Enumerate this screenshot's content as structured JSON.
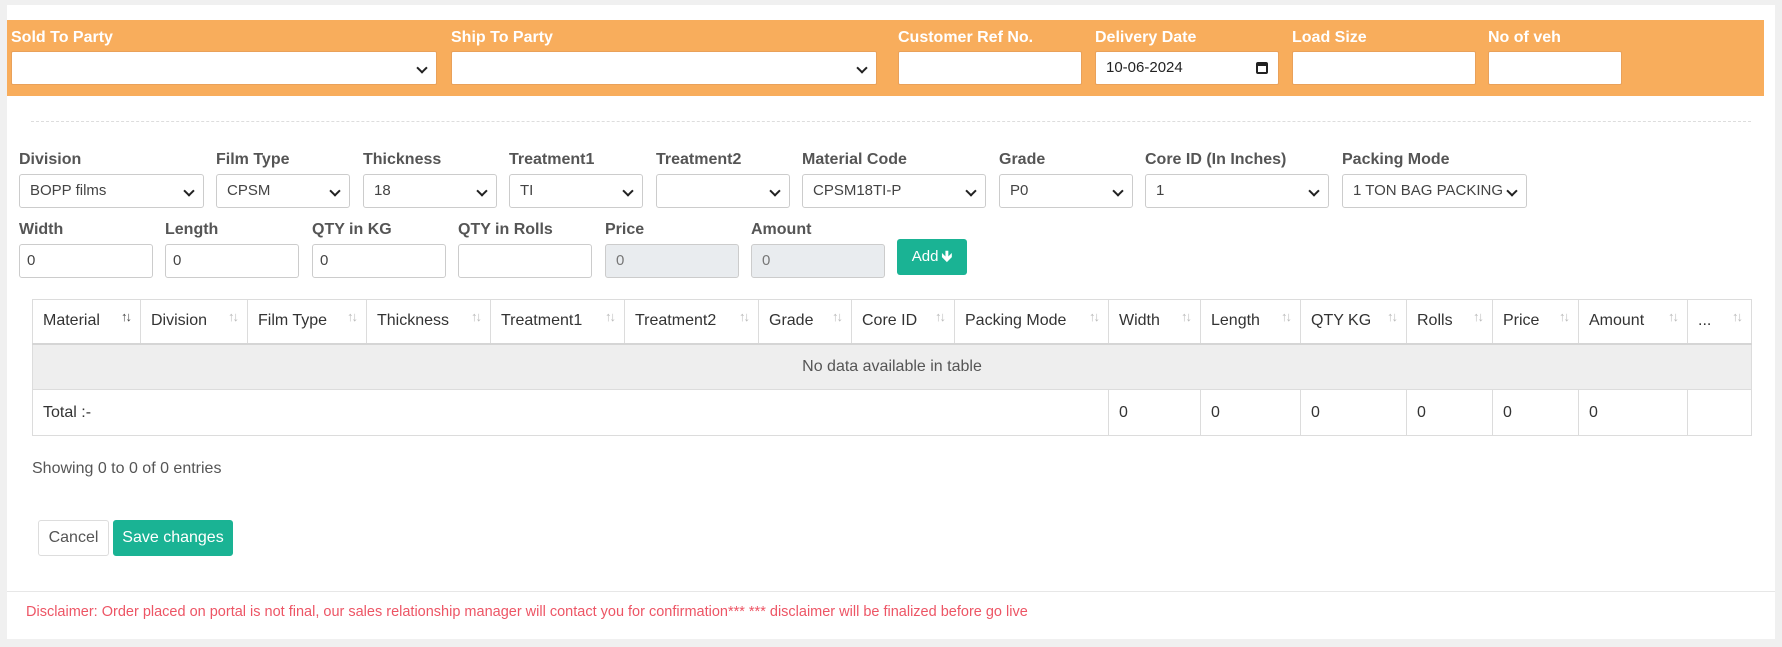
{
  "header": {
    "sold_to": {
      "label": "Sold To Party",
      "value": ""
    },
    "ship_to": {
      "label": "Ship To Party",
      "value": ""
    },
    "customer_ref": {
      "label": "Customer Ref No.",
      "value": ""
    },
    "delivery_date": {
      "label": "Delivery Date",
      "value": "10-06-2024"
    },
    "load_size": {
      "label": "Load Size",
      "value": ""
    },
    "no_of_veh": {
      "label": "No of veh",
      "value": ""
    }
  },
  "form": {
    "division": {
      "label": "Division",
      "value": "BOPP films"
    },
    "film_type": {
      "label": "Film Type",
      "value": "CPSM"
    },
    "thickness": {
      "label": "Thickness",
      "value": "18"
    },
    "treatment1": {
      "label": "Treatment1",
      "value": "TI"
    },
    "treatment2": {
      "label": "Treatment2",
      "value": ""
    },
    "material_code": {
      "label": "Material Code",
      "value": "CPSM18TI-P"
    },
    "grade": {
      "label": "Grade",
      "value": "P0"
    },
    "core_id": {
      "label": "Core ID (In Inches)",
      "value": "1"
    },
    "packing_mode": {
      "label": "Packing Mode",
      "value": "1 TON BAG PACKING"
    },
    "width": {
      "label": "Width",
      "value": "0"
    },
    "length": {
      "label": "Length",
      "value": "0"
    },
    "qty_kg": {
      "label": "QTY in KG",
      "value": "0"
    },
    "qty_rolls": {
      "label": "QTY in Rolls",
      "value": ""
    },
    "price": {
      "label": "Price",
      "value": "0"
    },
    "amount": {
      "label": "Amount",
      "value": "0"
    },
    "add_label": "Add"
  },
  "table": {
    "columns": [
      "Material",
      "Division",
      "Film Type",
      "Thickness",
      "Treatment1",
      "Treatment2",
      "Grade",
      "Core ID",
      "Packing Mode",
      "Width",
      "Length",
      "QTY KG",
      "Rolls",
      "Price",
      "Amount",
      "..."
    ],
    "empty_message": "No data available in table",
    "total_label": "Total :-",
    "totals": [
      "0",
      "0",
      "0",
      "0",
      "0",
      "0"
    ],
    "info": "Showing 0 to 0 of 0 entries"
  },
  "actions": {
    "cancel": "Cancel",
    "save": "Save changes"
  },
  "disclaimer": "Disclaimer: Order placed on portal is not final, our sales relationship manager will contact you for confirmation*** *** disclaimer will be finalized before go live",
  "colors": {
    "header_band": "#f8ad5c",
    "primary": "#1ab394",
    "disclaimer": "#ed5565"
  },
  "icons": {
    "sort": "sort-arrows-icon",
    "dropdown": "chevron-down-icon",
    "calendar": "calendar-icon",
    "add": "arrow-down-icon"
  }
}
